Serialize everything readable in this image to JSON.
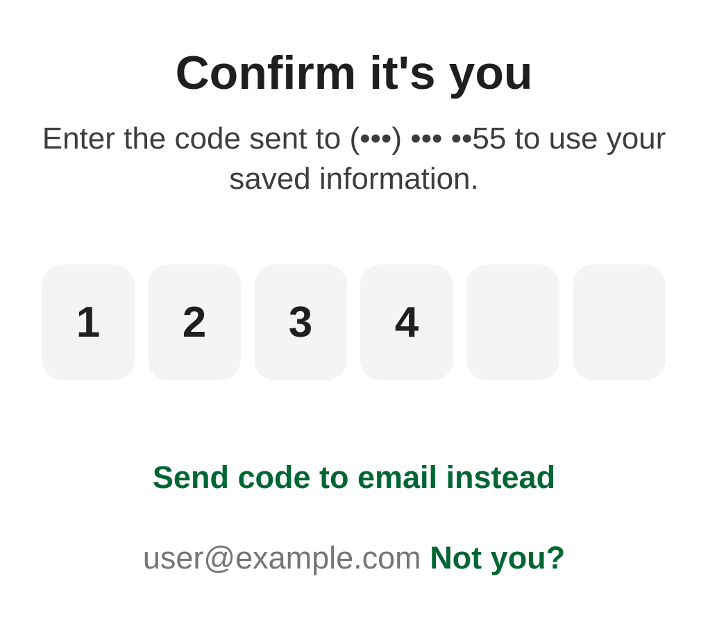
{
  "title": "Confirm it's you",
  "subtitle": "Enter the code sent to (•••) ••• ••55 to use your saved information.",
  "code_digits": [
    "1",
    "2",
    "3",
    "4",
    "",
    ""
  ],
  "send_email_link": "Send code to email instead",
  "footer": {
    "email": "user@example.com",
    "not_you": "Not you?"
  },
  "colors": {
    "accent": "#006633",
    "box_bg": "#f4f4f4",
    "muted": "#757575"
  }
}
